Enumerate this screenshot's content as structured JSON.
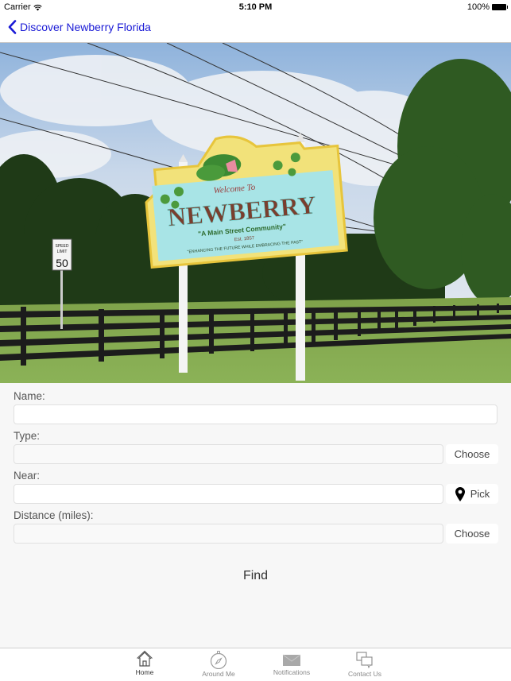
{
  "status_bar": {
    "carrier": "Carrier",
    "time": "5:10 PM",
    "battery": "100%"
  },
  "nav": {
    "back_label": "Discover Newberry Florida",
    "accent_color": "#1a1ad6"
  },
  "hero": {
    "sign": {
      "welcome": "Welcome To",
      "town": "NEWBERRY",
      "slogan": "\"A Main Street Community\"",
      "established": "Est. 1857",
      "motto": "\"ENHANCING THE FUTURE WHILE EMBRACING THE PAST\""
    },
    "speed_sign": {
      "line1": "SPEED",
      "line2": "LIMIT",
      "value": "50"
    }
  },
  "form": {
    "name": {
      "label": "Name:",
      "value": "",
      "placeholder": ""
    },
    "type": {
      "label": "Type:",
      "value": "",
      "button": "Choose"
    },
    "near": {
      "label": "Near:",
      "value": "",
      "button": "Pick"
    },
    "distance": {
      "label": "Distance (miles):",
      "value": "",
      "button": "Choose"
    },
    "find_label": "Find"
  },
  "tab_bar": {
    "items": [
      {
        "label": "Home",
        "icon": "home-icon",
        "active": true
      },
      {
        "label": "Around Me",
        "icon": "compass-icon",
        "active": false
      },
      {
        "label": "Notifications",
        "icon": "envelope-icon",
        "active": false
      },
      {
        "label": "Contact Us",
        "icon": "chat-bubbles-icon",
        "active": false
      }
    ]
  }
}
